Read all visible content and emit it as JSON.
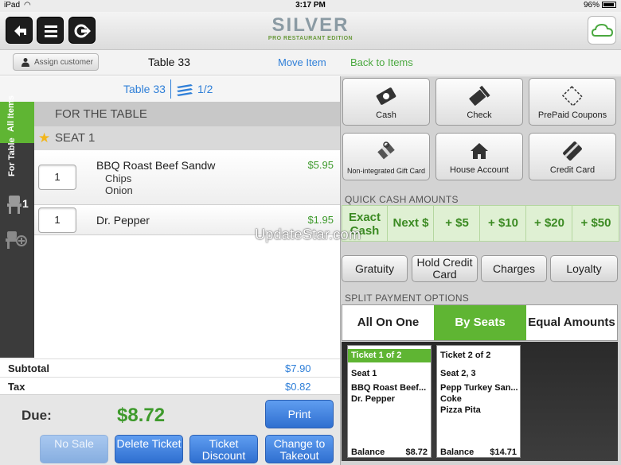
{
  "status_bar": {
    "device": "iPad",
    "time": "3:17 PM",
    "battery": "96%"
  },
  "header": {
    "logo_main": "SILVER",
    "logo_sub": "PRO RESTAURANT EDITION"
  },
  "toolbar": {
    "assign_customer": "Assign customer",
    "table_title": "Table 33",
    "move_item": "Move Item",
    "back_to_items": "Back to Items"
  },
  "split_header": {
    "table": "Table 33",
    "fraction": "1/2"
  },
  "side_tabs": {
    "all_items": "All Items",
    "for_table": "For Table",
    "seat_count": "1"
  },
  "order": {
    "section_title": "FOR THE TABLE",
    "seat_title": "SEAT 1",
    "items": [
      {
        "qty": "1",
        "name": "BBQ Roast Beef Sandw",
        "price": "$5.95",
        "modifiers": [
          "Chips",
          "Onion"
        ]
      },
      {
        "qty": "1",
        "name": "Dr. Pepper",
        "price": "$1.95",
        "modifiers": []
      }
    ]
  },
  "totals": {
    "subtotal_label": "Subtotal",
    "subtotal_value": "$7.90",
    "tax_label": "Tax",
    "tax_value": "$0.82"
  },
  "due": {
    "label": "Due:",
    "amount": "$8.72"
  },
  "actions": {
    "print": "Print",
    "no_sale": "No Sale",
    "delete_ticket": "Delete Ticket",
    "ticket_discount": "Ticket Discount",
    "change_to_takeout": "Change to Takeout"
  },
  "payment_methods": [
    {
      "label": "Cash",
      "icon": "cash-icon"
    },
    {
      "label": "Check",
      "icon": "check-icon"
    },
    {
      "label": "PrePaid Coupons",
      "icon": "coupon-icon"
    },
    {
      "label": "Non-integrated Gift Card",
      "icon": "gift-icon"
    },
    {
      "label": "House Account",
      "icon": "house-icon"
    },
    {
      "label": "Credit Card",
      "icon": "credit-card-icon"
    }
  ],
  "quick_cash": {
    "title": "QUICK CASH AMOUNTS",
    "options": [
      "Exact Cash",
      "Next $",
      "+ $5",
      "+ $10",
      "+ $20",
      "+ $50"
    ]
  },
  "extras": [
    "Gratuity",
    "Hold Credit Card",
    "Charges",
    "Loyalty"
  ],
  "split": {
    "title": "SPLIT PAYMENT OPTIONS",
    "options": [
      "All On One",
      "By Seats",
      "Equal Amounts"
    ],
    "selected": "By Seats"
  },
  "tickets": [
    {
      "header": "Ticket 1 of 2",
      "seat": "Seat 1",
      "items": [
        "BBQ Roast Beef...",
        "Dr. Pepper"
      ],
      "balance_label": "Balance",
      "balance": "$8.72"
    },
    {
      "header": "Ticket 2 of 2",
      "seat": "Seat 2, 3",
      "items": [
        "Pepp Turkey San...",
        "Coke",
        "Pizza Pita"
      ],
      "balance_label": "Balance",
      "balance": "$14.71"
    }
  ],
  "watermark": "UpdateStar.com",
  "colors": {
    "green": "#5fb533",
    "blue": "#2f7fd8",
    "price_green": "#3e9a2c"
  }
}
